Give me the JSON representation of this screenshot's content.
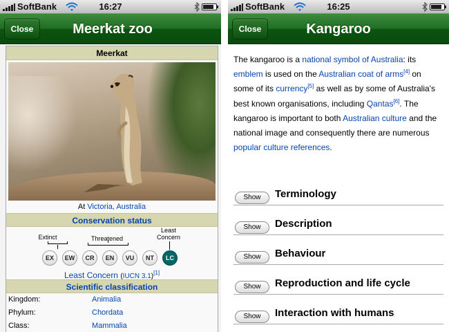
{
  "status_bar": {
    "left": {
      "carrier": "SoftBank",
      "time": "16:27"
    },
    "right": {
      "carrier": "SoftBank",
      "time": "16:25"
    },
    "battery_level": 0.85
  },
  "left_screen": {
    "nav": {
      "close_label": "Close",
      "title": "Meerkat zoo"
    },
    "infobox": {
      "title": "Meerkat",
      "caption_prefix": "At",
      "caption_link": "Victoria, Australia",
      "conservation_header": "Conservation status",
      "labels": {
        "extinct": "Extinct",
        "threatened": "Threatened",
        "least_concern": "Least Concern"
      },
      "status_codes": [
        "EX",
        "EW",
        "CR",
        "EN",
        "VU",
        "NT",
        "LC"
      ],
      "active_code": "LC",
      "least_concern_text": "Least Concern",
      "iucn": "(IUCN 3.1)",
      "iucn_ref": "[1]",
      "sci_header": "Scientific classification",
      "classification": [
        {
          "key": "Kingdom:",
          "value": "Animalia"
        },
        {
          "key": "Phylum:",
          "value": "Chordata"
        },
        {
          "key": "Class:",
          "value": "Mammalia"
        }
      ]
    }
  },
  "right_screen": {
    "nav": {
      "close_label": "Close",
      "title": "Kangaroo"
    },
    "paragraph": {
      "t1": "The kangaroo is a ",
      "l1": "national symbol of Australia",
      "t2": ": its ",
      "l2": "emblem",
      "t3": " is used on the ",
      "l3": "Australian coat of arms",
      "r1": "[4]",
      "t4": " on some of its ",
      "l4": "currency",
      "r2": "[5]",
      "t5": " as well as by some of Australia's best known organisations, including ",
      "l5": "Qantas",
      "r3": "[6]",
      "t6": ". The kangaroo is important to both ",
      "l6": "Australian culture",
      "t7": " and the national image and consequently there are numerous ",
      "l7": "popular culture references",
      "t8": "."
    },
    "show_label": "Show",
    "sections": [
      "Terminology",
      "Description",
      "Behaviour",
      "Reproduction and life cycle",
      "Interaction with humans"
    ]
  },
  "colors": {
    "nav_green": "#0d5410",
    "link_blue": "#0645ad",
    "infobox_header": "#d6d6b0",
    "lc_active": "#006666"
  }
}
